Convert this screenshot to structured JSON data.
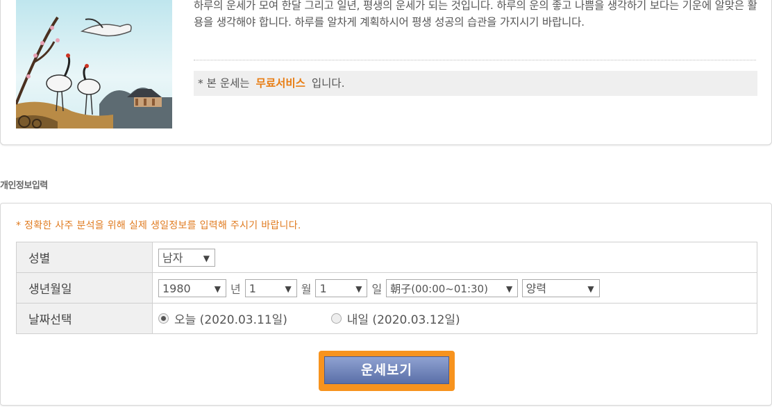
{
  "intro": {
    "description": "하루의 운세가 모여 한달 그리고 일년, 평생의 운세가 되는 것입니다. 하루의 운의 좋고 나쁨을 생각하기 보다는 기운에 알맞은 활용을 생각해야 합니다. 하루를 알차게 계획하시어 평생 성공의 습관을 가지시기 바랍니다.",
    "notice_prefix": "* 본 운세는",
    "notice_highlight": "무료서비스",
    "notice_suffix": "입니다.",
    "highlight_color": "#e87d13"
  },
  "section_title": "개인정보입력",
  "form": {
    "warning": "* 정확한 사주 분석을 위해 실제 생일정보를 입력해 주시기 바랍니다.",
    "gender_label": "성별",
    "gender_value": "남자",
    "birth_label": "생년월일",
    "year_value": "1980",
    "year_unit": "년",
    "month_value": "1",
    "month_unit": "월",
    "day_value": "1",
    "day_unit": "일",
    "time_value": "朝子(00:00~01:30)",
    "calendar_value": "양력",
    "date_label": "날짜선택",
    "today_option": "오늘 (2020.03.11일)",
    "tomorrow_option": "내일 (2020.03.12일)",
    "selected": "today"
  },
  "submit_label": "운세보기",
  "icons": {
    "dropdown": "chevron-down-icon",
    "radio": "radio-icon"
  },
  "colors": {
    "accent_orange": "#f7931e",
    "button_blue": "#5a6fa8"
  }
}
